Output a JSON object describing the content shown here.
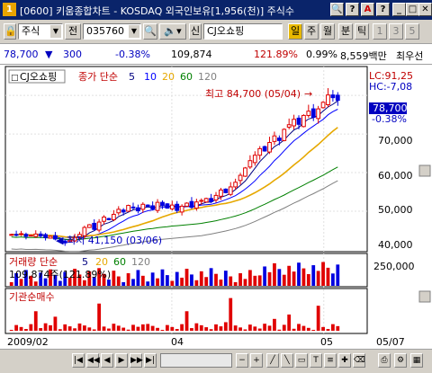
{
  "window": {
    "title": "[0600] 키움종합차트 - KOSDAQ 외국인보유[1,956(천)] 주식수",
    "icon_label": "1",
    "buttons": [
      "🔍",
      "?",
      "A",
      "?",
      "_",
      "□",
      "✕"
    ]
  },
  "toolbar": {
    "market_select": "주식",
    "period_label": "전",
    "code_value": "035760",
    "stock_name": "CJ오쇼핑",
    "new_label": "신",
    "period_tabs": [
      "일",
      "주",
      "월",
      "분",
      "틱",
      "1",
      "3",
      "5"
    ],
    "active_period": "일"
  },
  "infobar": {
    "price": "78,700",
    "change": "300",
    "change_pct": "-0.38%",
    "volume": "109,874",
    "name": "CJ오쇼핑",
    "volume_ratio": "121.89%",
    "turnover": "0.99%",
    "amount": "8,559백만",
    "last_label": "최우선"
  },
  "price_panel": {
    "name_tag": "CJ오쇼핑",
    "ma_title": "종가 단순",
    "ma_periods": [
      "5",
      "10",
      "20",
      "60",
      "120"
    ],
    "ma_colors": [
      "#000080",
      "#0000ff",
      "#e6a800",
      "#008000",
      "#808080"
    ],
    "lc_label": "LC:91,25",
    "hc_label": "HC:-7,08",
    "high_label": "최고 84,700 (05/04)",
    "low_label": "최저 41,150 (03/06)",
    "current_tag": "78,700",
    "current_pct": "-0.38%",
    "y_ticks": [
      "80,000",
      "70,000",
      "60,000",
      "50,000",
      "40,000"
    ]
  },
  "volume_panel": {
    "title": "거래량 단순",
    "ma_periods": [
      "5",
      "20",
      "60",
      "120"
    ],
    "value_label": "109,874주(121.89%)",
    "y_tick": "250,000"
  },
  "inst_panel": {
    "title": "기관순매수"
  },
  "x_axis": {
    "labels": [
      "2009/02",
      "04",
      "05",
      "05/07"
    ]
  },
  "chart_data": {
    "type": "candlestick",
    "price_ylim": [
      40000,
      87000
    ],
    "price_high": 84700,
    "price_low": 41150,
    "last_close": 78700,
    "closes": [
      44000,
      43800,
      44200,
      43500,
      43800,
      44100,
      43600,
      43200,
      43500,
      42800,
      42300,
      41800,
      42500,
      43200,
      44000,
      45800,
      46500,
      45300,
      47200,
      48500,
      47800,
      49200,
      50500,
      49800,
      51500,
      50900,
      50100,
      51800,
      51200,
      50600,
      52300,
      51500,
      50800,
      51600,
      50200,
      51300,
      52100,
      51000,
      52400,
      52800,
      53300,
      52500,
      54100,
      55500,
      54800,
      56300,
      57500,
      59300,
      61200,
      63100,
      64500,
      66200,
      65600,
      67800,
      69500,
      68300,
      71200,
      72400,
      73800,
      72500,
      74800,
      75900,
      74300,
      76500,
      78200,
      80100,
      79400,
      78700
    ],
    "volume_ylim": [
      0,
      400000
    ],
    "inst_scale": "relative"
  }
}
